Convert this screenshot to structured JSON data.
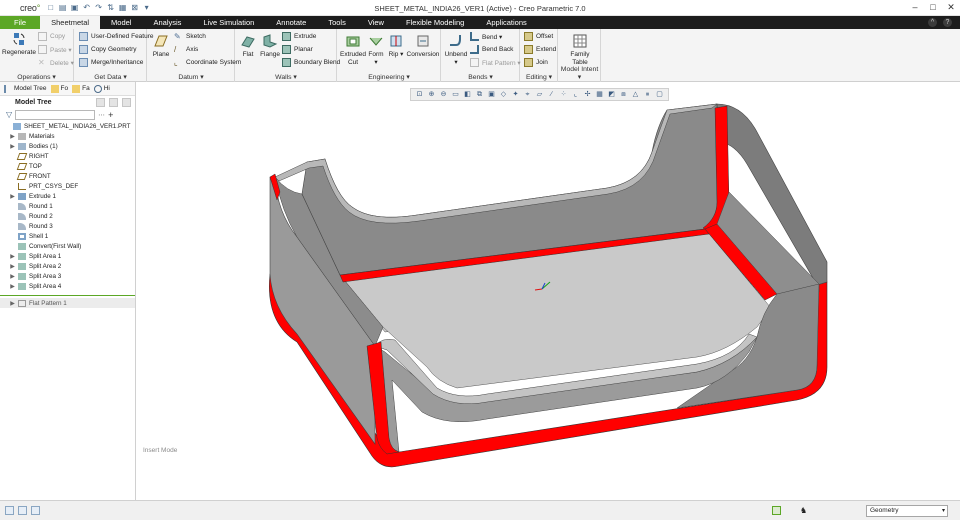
{
  "window": {
    "title": "SHEET_METAL_INDIA26_VER1 (Active) - Creo Parametric 7.0",
    "logo_text": "creo",
    "logo_accent": "°"
  },
  "tabs": [
    {
      "label": "File"
    },
    {
      "label": "Sheetmetal"
    },
    {
      "label": "Model"
    },
    {
      "label": "Analysis"
    },
    {
      "label": "Live Simulation"
    },
    {
      "label": "Annotate"
    },
    {
      "label": "Tools"
    },
    {
      "label": "View"
    },
    {
      "label": "Flexible Modeling"
    },
    {
      "label": "Applications"
    }
  ],
  "ribbon": {
    "operations": {
      "label": "Operations ▾",
      "regenerate": "Regenerate",
      "copy": "Copy",
      "paste": "Paste ▾",
      "delete": "Delete ▾"
    },
    "get_data": {
      "label": "Get Data ▾",
      "udf": "User-Defined Feature",
      "copy_geometry": "Copy Geometry",
      "merge": "Merge/Inheritance"
    },
    "datum": {
      "label": "Datum ▾",
      "plane": "Plane",
      "sketch": "Sketch",
      "axis": "Axis",
      "csys": "Coordinate System"
    },
    "walls": {
      "label": "Walls ▾",
      "flat": "Flat",
      "flange": "Flange",
      "extrude": "Extrude",
      "planar": "Planar",
      "boundary_blend": "Boundary Blend"
    },
    "engineering": {
      "label": "Engineering ▾",
      "extruded_cut": "Extruded Cut",
      "form": "Form ▾",
      "rip": "Rip ▾",
      "conversion": "Conversion"
    },
    "bends": {
      "label": "Bends ▾",
      "unbend": "Unbend ▾",
      "bend": "Bend ▾",
      "bend_back": "Bend Back",
      "flat_pattern": "Flat Pattern ▾"
    },
    "editing": {
      "label": "Editing ▾",
      "offset": "Offset",
      "extend": "Extend",
      "join": "Join"
    },
    "model_intent": {
      "label": "Model Intent ▾",
      "family_table": "Family Table"
    }
  },
  "navigator": {
    "tabs": [
      {
        "label": "Model Tree"
      },
      {
        "label": "Fo"
      },
      {
        "label": "Fa"
      },
      {
        "label": "Hi"
      }
    ],
    "tree_header": "Model Tree",
    "tree": [
      {
        "label": "SHEET_METAL_INDIA26_VER1.PRT",
        "expand": ""
      },
      {
        "label": "Materials",
        "expand": "▶"
      },
      {
        "label": "Bodies (1)",
        "expand": "▶"
      },
      {
        "label": "RIGHT",
        "expand": ""
      },
      {
        "label": "TOP",
        "expand": ""
      },
      {
        "label": "FRONT",
        "expand": ""
      },
      {
        "label": "PRT_CSYS_DEF",
        "expand": ""
      },
      {
        "label": "Extrude 1",
        "expand": "▶"
      },
      {
        "label": "Round 1",
        "expand": ""
      },
      {
        "label": "Round 2",
        "expand": ""
      },
      {
        "label": "Round 3",
        "expand": ""
      },
      {
        "label": "Shell 1",
        "expand": ""
      },
      {
        "label": "Convert(First Wall)",
        "expand": ""
      },
      {
        "label": "Split Area 1",
        "expand": "▶"
      },
      {
        "label": "Split Area 2",
        "expand": "▶"
      },
      {
        "label": "Split Area 3",
        "expand": "▶"
      },
      {
        "label": "Split Area 4",
        "expand": "▶"
      }
    ],
    "flat_pattern_item": "Flat Pattern 1"
  },
  "graphics": {
    "mode_text": "Insert Mode"
  },
  "statusbar": {
    "selection_filter": "Geometry"
  },
  "colors": {
    "file_tab": "#5ca726",
    "tab_bar": "#1d1d1d",
    "bend_red": "#ff0000",
    "model_gray": "#9a9a9a"
  }
}
